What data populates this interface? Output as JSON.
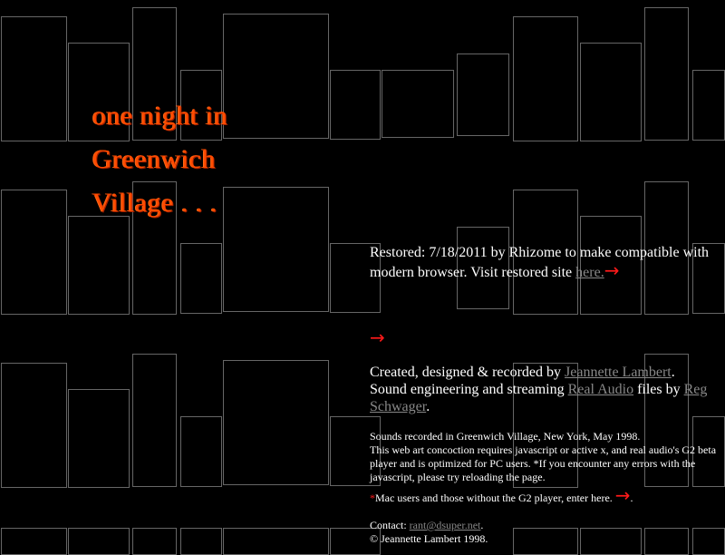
{
  "title": {
    "line1": "one night in",
    "line2": "Greenwich",
    "line3": "Village . . ."
  },
  "restored": {
    "text": "Restored: 7/18/2011 by Rhizome to make compatible with modern browser. Visit restored site ",
    "link": "here.",
    "arrow": "→"
  },
  "enter_arrow": "→",
  "credits": {
    "created": "Created, designed & recorded by ",
    "created_link": "Jeannette Lambert",
    "period1": ".",
    "sound": "Sound engineering and streaming ",
    "realaudio_link": "Real Audio",
    "files_by": " files by ",
    "reg_link": "Reg Schwager",
    "period2": "."
  },
  "info": {
    "line1": "Sounds recorded in Greenwich Village, New York, May 1998.",
    "line2": "This web art concoction requires javascript or active x, and real audio's G2 beta player and is optimized for PC users. *If you encounter any errors with the javascript, please try reloading the page."
  },
  "mac": {
    "star": "*",
    "text": "Mac users and those without the G2 player, enter here.",
    "arrow": "→",
    "period": "."
  },
  "contact": {
    "label": "Contact: ",
    "email": "rant@dsuper.net",
    "period": ".",
    "copyright": "© Jeannette Lambert 1998."
  },
  "colors": {
    "background": "#000000",
    "title": "#ff4b00",
    "arrow": "#ff1a1a",
    "link": "#888888",
    "outline": "#666666"
  },
  "icons": [
    "right-arrow-icon"
  ]
}
